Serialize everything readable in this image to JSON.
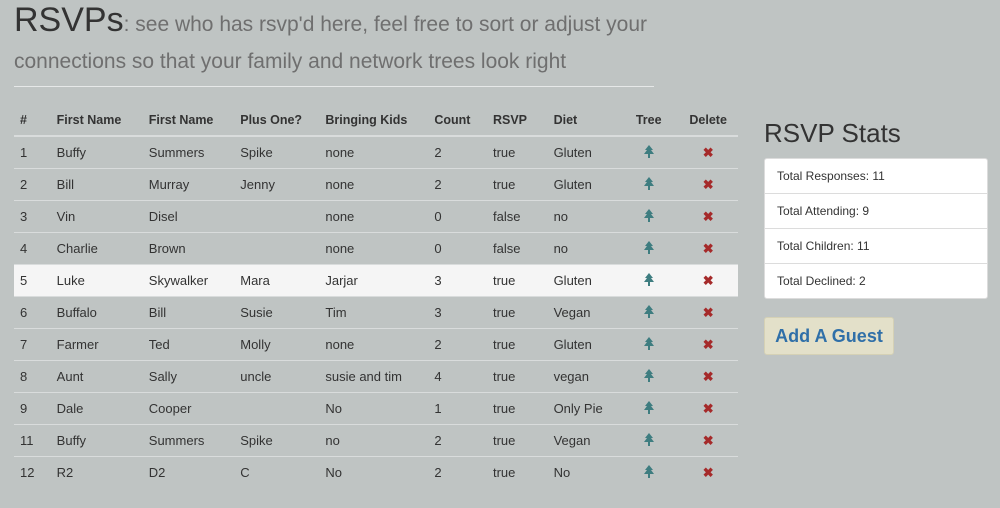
{
  "header": {
    "title": "RSVPs",
    "subtitle": ": see who has rsvp'd here, feel free to sort or adjust your connections so that your family and network trees look right"
  },
  "table": {
    "columns": [
      "#",
      "First Name",
      "First Name",
      "Plus One?",
      "Bringing Kids",
      "Count",
      "RSVP",
      "Diet",
      "Tree",
      "Delete"
    ],
    "rows": [
      {
        "num": "1",
        "first": "Buffy",
        "last": "Summers",
        "plus_one": "Spike",
        "kids": "none",
        "count": "2",
        "rsvp": "true",
        "diet": "Gluten"
      },
      {
        "num": "2",
        "first": "Bill",
        "last": "Murray",
        "plus_one": "Jenny",
        "kids": "none",
        "count": "2",
        "rsvp": "true",
        "diet": "Gluten"
      },
      {
        "num": "3",
        "first": "Vin",
        "last": "Disel",
        "plus_one": "",
        "kids": "none",
        "count": "0",
        "rsvp": "false",
        "diet": "no"
      },
      {
        "num": "4",
        "first": "Charlie",
        "last": "Brown",
        "plus_one": "",
        "kids": "none",
        "count": "0",
        "rsvp": "false",
        "diet": "no"
      },
      {
        "num": "5",
        "first": "Luke",
        "last": "Skywalker",
        "plus_one": "Mara",
        "kids": "Jarjar",
        "count": "3",
        "rsvp": "true",
        "diet": "Gluten"
      },
      {
        "num": "6",
        "first": "Buffalo",
        "last": "Bill",
        "plus_one": "Susie",
        "kids": "Tim",
        "count": "3",
        "rsvp": "true",
        "diet": "Vegan"
      },
      {
        "num": "7",
        "first": "Farmer",
        "last": "Ted",
        "plus_one": "Molly",
        "kids": "none",
        "count": "2",
        "rsvp": "true",
        "diet": "Gluten"
      },
      {
        "num": "8",
        "first": "Aunt",
        "last": "Sally",
        "plus_one": "uncle",
        "kids": "susie and tim",
        "count": "4",
        "rsvp": "true",
        "diet": "vegan"
      },
      {
        "num": "9",
        "first": "Dale",
        "last": "Cooper",
        "plus_one": "",
        "kids": "No",
        "count": "1",
        "rsvp": "true",
        "diet": "Only Pie"
      },
      {
        "num": "11",
        "first": "Buffy",
        "last": "Summers",
        "plus_one": "Spike",
        "kids": "no",
        "count": "2",
        "rsvp": "true",
        "diet": "Vegan"
      },
      {
        "num": "12",
        "first": "R2",
        "last": "D2",
        "plus_one": "C",
        "kids": "No",
        "count": "2",
        "rsvp": "true",
        "diet": "No"
      }
    ],
    "tree_icon": "tree-icon",
    "delete_icon": "close-icon"
  },
  "stats": {
    "title": "RSVP Stats",
    "items": [
      "Total Responses: 11",
      "Total Attending: 9",
      "Total Children: 11",
      "Total Declined: 2"
    ]
  },
  "add_guest_label": "Add A Guest",
  "colors": {
    "background": "#bfc4c3",
    "tree_icon": "#3e7d80",
    "delete_icon": "#a52a2a",
    "button_bg": "#e3e0c9",
    "button_text": "#2f6fa8"
  }
}
